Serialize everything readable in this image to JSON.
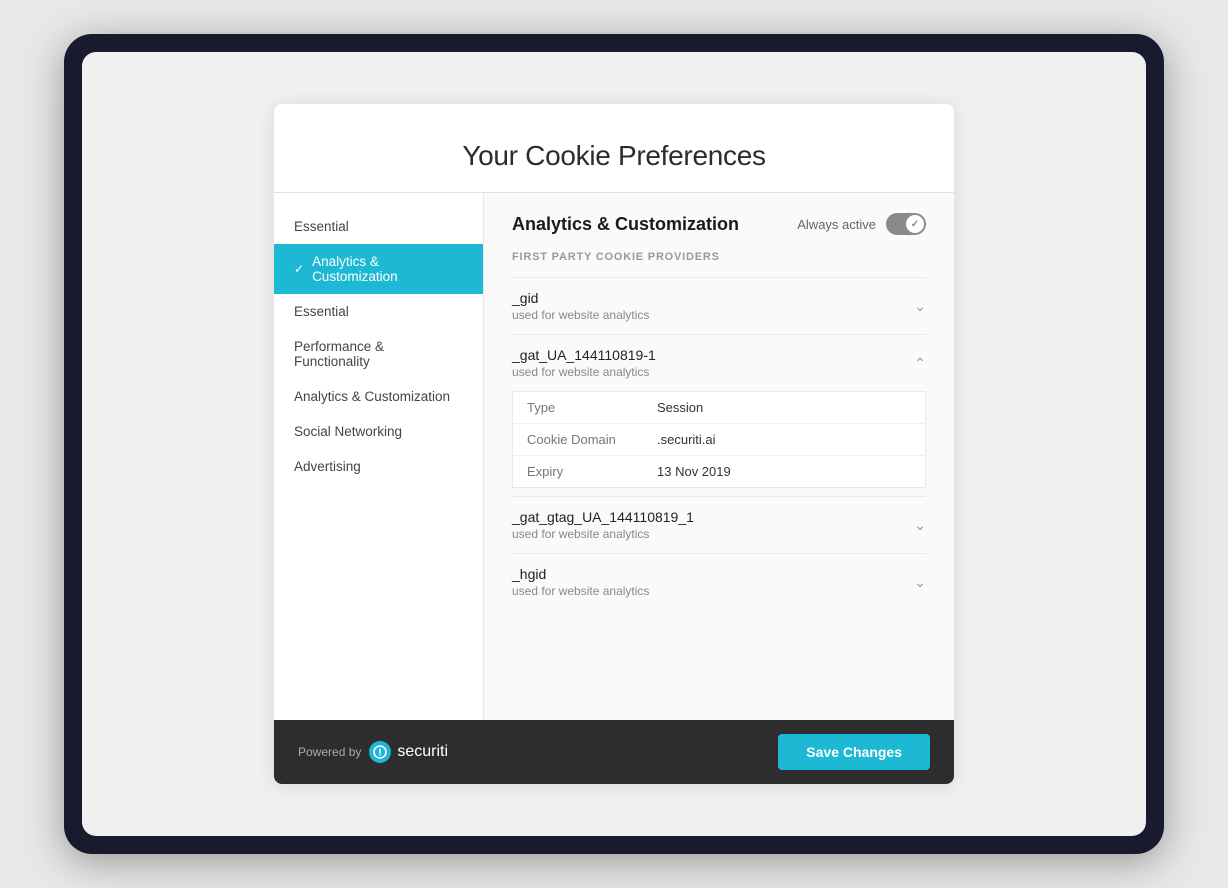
{
  "page": {
    "title": "Your Cookie Preferences"
  },
  "sidebar": {
    "items": [
      {
        "id": "essential-top",
        "label": "Essential",
        "active": false
      },
      {
        "id": "analytics-customization",
        "label": "Analytics & Customization",
        "active": true
      },
      {
        "id": "essential",
        "label": "Essential",
        "active": false
      },
      {
        "id": "performance-functionality",
        "label": "Performance & Functionality",
        "active": false
      },
      {
        "id": "analytics-customization-2",
        "label": "Analytics & Customization",
        "active": false
      },
      {
        "id": "social-networking",
        "label": "Social Networking",
        "active": false
      },
      {
        "id": "advertising",
        "label": "Advertising",
        "active": false
      }
    ]
  },
  "content": {
    "section_title": "Analytics & Customization",
    "always_active_label": "Always active",
    "first_party_label": "FIRST PARTY COOKIE PROVIDERS",
    "cookies": [
      {
        "id": "gid",
        "name": "_gid",
        "description": "used for website analytics",
        "expanded": false
      },
      {
        "id": "gat_ua",
        "name": "_gat_UA_144110819-1",
        "description": "used for website analytics",
        "expanded": true,
        "details": [
          {
            "label": "Type",
            "value": "Session"
          },
          {
            "label": "Cookie Domain",
            "value": ".securiti.ai"
          },
          {
            "label": "Expiry",
            "value": "13 Nov 2019"
          }
        ]
      },
      {
        "id": "gat_gtag",
        "name": "_gat_gtag_UA_144110819_1",
        "description": "used for website analytics",
        "expanded": false
      },
      {
        "id": "hgid",
        "name": "_hgid",
        "description": "used for website analytics",
        "expanded": false
      }
    ]
  },
  "footer": {
    "powered_by_label": "Powered by",
    "brand_name": "securiti",
    "save_label": "Save Changes"
  },
  "colors": {
    "active_bg": "#1db8d4",
    "toggle_bg": "#8a8a8a",
    "save_btn": "#1db8d4"
  }
}
